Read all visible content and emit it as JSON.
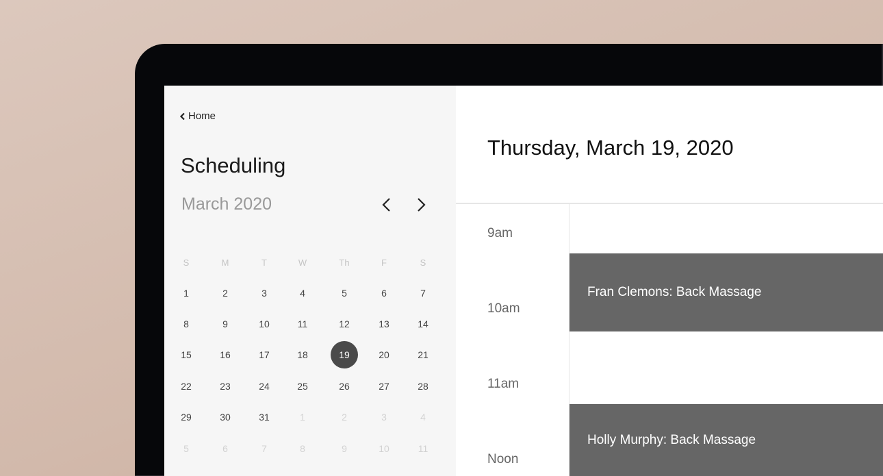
{
  "sidebar": {
    "back_label": "Home",
    "title": "Scheduling",
    "month_label": "March 2020",
    "weekdays": [
      "S",
      "M",
      "T",
      "W",
      "Th",
      "F",
      "S"
    ],
    "weeks": [
      [
        "1",
        "2",
        "3",
        "4",
        "5",
        "6",
        "7"
      ],
      [
        "8",
        "9",
        "10",
        "11",
        "12",
        "13",
        "14"
      ],
      [
        "15",
        "16",
        "17",
        "18",
        "19",
        "20",
        "21"
      ],
      [
        "22",
        "23",
        "24",
        "25",
        "26",
        "27",
        "28"
      ],
      [
        "29",
        "30",
        "31",
        "1",
        "2",
        "3",
        "4"
      ],
      [
        "5",
        "6",
        "7",
        "8",
        "9",
        "10",
        "11"
      ]
    ],
    "selected_day": "19"
  },
  "main": {
    "date_title": "Thursday, March 19, 2020",
    "times": [
      "9am",
      "10am",
      "11am",
      "Noon"
    ],
    "events": [
      {
        "label": "Fran Clemons: Back Massage"
      },
      {
        "label": "Holly Murphy: Back Massage"
      }
    ],
    "event_color": "#666666"
  }
}
